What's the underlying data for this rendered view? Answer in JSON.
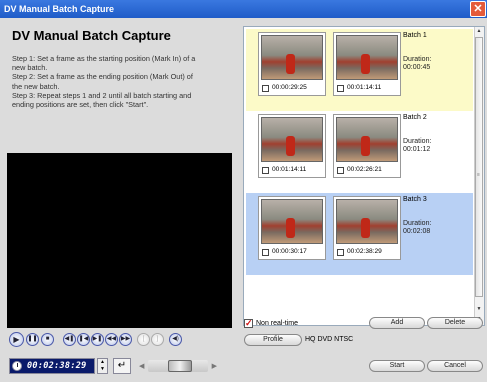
{
  "window": {
    "title": "DV Manual Batch Capture",
    "close_glyph": "✕"
  },
  "heading": "DV Manual Batch Capture",
  "instructions": [
    "Step 1: Set a frame as the starting position (Mark In) of a",
    "new batch.",
    "Step 2: Set a frame as the ending position (Mark Out) of",
    "the new batch.",
    "Step 3: Repeat steps 1 and 2 until all batch starting and",
    "ending positions are set, then click \"Start\"."
  ],
  "player": {
    "controls": [
      {
        "name": "play-icon",
        "glyph": "▶"
      },
      {
        "name": "pause-icon",
        "glyph": "❚❚"
      },
      {
        "name": "stop-icon",
        "glyph": "■"
      },
      {
        "name": "go-to-start-icon",
        "glyph": "◀❚"
      },
      {
        "name": "previous-frame-icon",
        "glyph": "❚◀"
      },
      {
        "name": "next-frame-icon",
        "glyph": "▶❚"
      },
      {
        "name": "rewind-icon",
        "glyph": "◀◀"
      },
      {
        "name": "fast-forward-icon",
        "glyph": "▶▶"
      },
      {
        "name": "mark-in-icon",
        "glyph": "["
      },
      {
        "name": "mark-out-icon",
        "glyph": "]"
      },
      {
        "name": "volume-icon",
        "glyph": "◀)"
      }
    ],
    "timecode": "00:02:38:29",
    "enter_glyph": "↵",
    "spin_up": "▲",
    "spin_down": "▼",
    "scrub_left": "◀",
    "scrub_right": "▶"
  },
  "batches": [
    {
      "name": "Batch 1",
      "mark_in": "00:00:29:25",
      "mark_out": "00:01:14:11",
      "duration_label": "Duration:",
      "duration": "00:00:45",
      "selected": false,
      "highlight": "#fcfac8"
    },
    {
      "name": "Batch 2",
      "mark_in": "00:01:14:11",
      "mark_out": "00:02:26:21",
      "duration_label": "Duration:",
      "duration": "00:01:12",
      "selected": false,
      "highlight": "#ffffff"
    },
    {
      "name": "Batch 3",
      "mark_in": "00:00:30:17",
      "mark_out": "00:02:38:29",
      "duration_label": "Duration:",
      "duration": "00:02:08",
      "selected": true,
      "highlight": "#b8d0f4"
    }
  ],
  "scrollbar": {
    "up_glyph": "▲",
    "down_glyph": "▼",
    "bottom_glyph": "▼"
  },
  "options": {
    "non_realtime_label": "Non real-time",
    "non_realtime_checked": true,
    "check_glyph": "✓"
  },
  "buttons": {
    "add": "Add",
    "delete": "Delete",
    "profile": "Profile",
    "start": "Start",
    "cancel": "Cancel"
  },
  "profile_value": "HQ DVD NTSC"
}
